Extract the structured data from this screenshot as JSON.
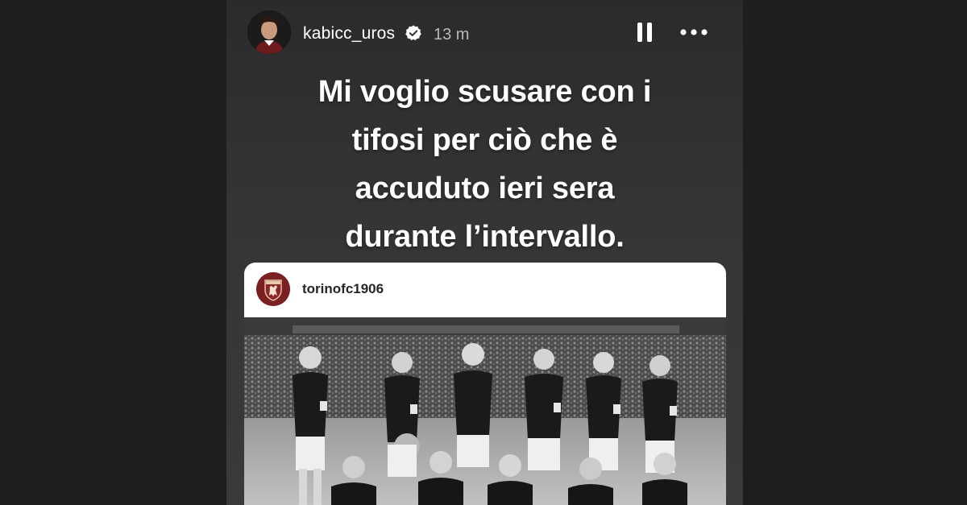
{
  "story": {
    "author": {
      "username": "kabicc_uros",
      "verified": true,
      "avatar_icon": "profile-photo",
      "posted_ago": "13 m"
    },
    "controls": {
      "pause_icon": "pause-icon",
      "more_icon": "more-options-icon"
    },
    "caption": {
      "lines": [
        "Mi voglio scusare con i",
        "tifosi per ciò che è",
        "accuduto ieri sera",
        "durante l’intervallo."
      ]
    },
    "shared_post": {
      "username": "torinofc1906",
      "avatar_icon": "torino-bull-crest",
      "photo": "black-and-white-team-photo"
    }
  },
  "colors": {
    "page_background": "#1e1e1e",
    "story_background": "#353535",
    "text_primary": "#ffffff",
    "text_secondary": "#b9b9b9",
    "card_background": "#ffffff",
    "club_maroon": "#7a1f22"
  }
}
